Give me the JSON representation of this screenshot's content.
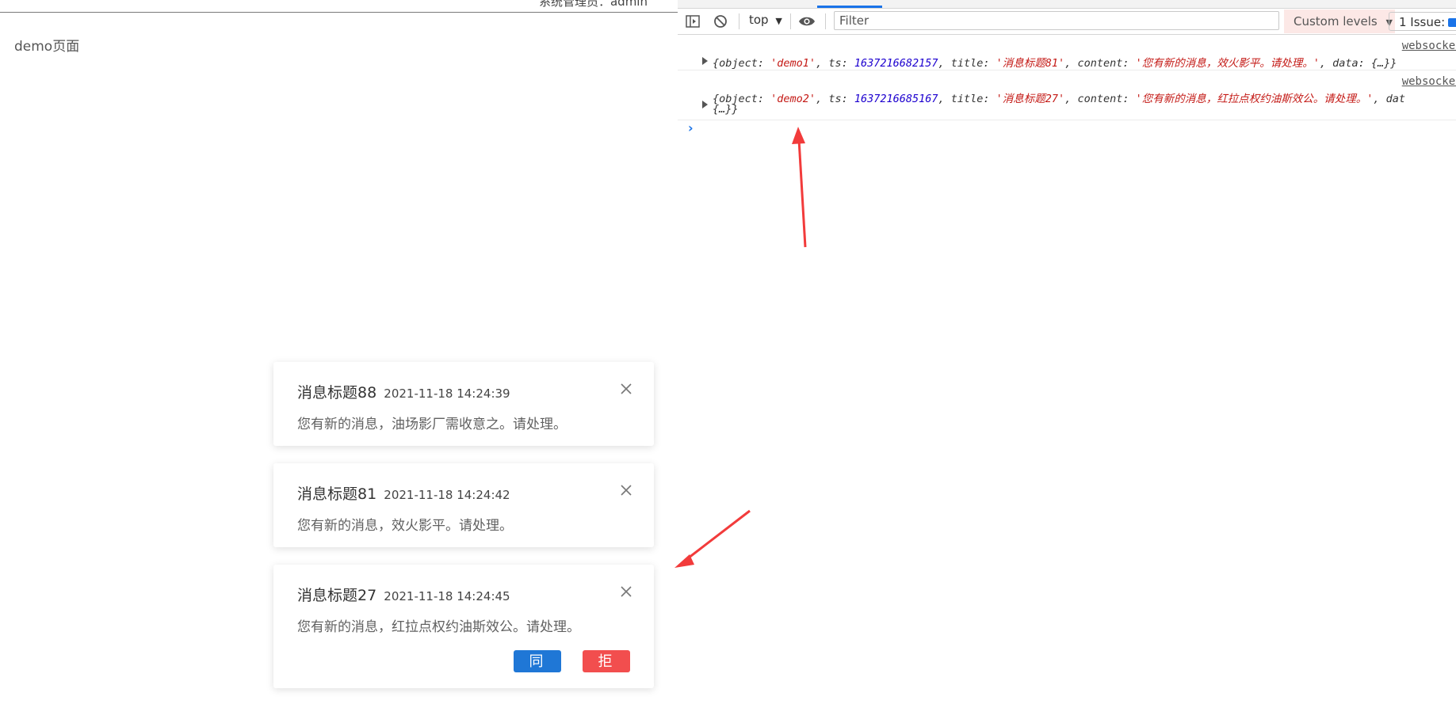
{
  "app": {
    "header_text": "系统管理员：admin",
    "page_title": "demo页面"
  },
  "notifications": [
    {
      "title": "消息标题88",
      "time": "2021-11-18 14:24:39",
      "content": "您有新的消息，油场影厂需收意之。请处理。"
    },
    {
      "title": "消息标题81",
      "time": "2021-11-18 14:24:42",
      "content": "您有新的消息，效火影平。请处理。"
    },
    {
      "title": "消息标题27",
      "time": "2021-11-18 14:24:45",
      "content": "您有新的消息，红拉点权约油斯效公。请处理。",
      "agree_label": "同意",
      "reject_label": "拒绝"
    }
  ],
  "devtools": {
    "context": "top",
    "filter_placeholder": "Filter",
    "levels_label": "Custom levels",
    "issues_label": "1 Issue:",
    "logs": [
      {
        "source": "websocket.",
        "line1": {
          "object": "'demo1'",
          "ts": "1637216682157",
          "title": "'消息标题81'",
          "content": "'您有新的消息，效火影平。请处理。'",
          "data": "{…}}"
        }
      },
      {
        "source": "websocket.",
        "line1": {
          "object": "'demo2'",
          "ts": "1637216685167",
          "title": "'消息标题27'",
          "content": "'您有新的消息，红拉点权约油斯效公。请处理。'",
          "data_key": "dat"
        },
        "line2": "{…}}"
      }
    ]
  },
  "colors": {
    "agree": "#1f77d6",
    "reject": "#f24e4e",
    "arrow": "#f23b3b",
    "accent": "#1a73e8"
  }
}
